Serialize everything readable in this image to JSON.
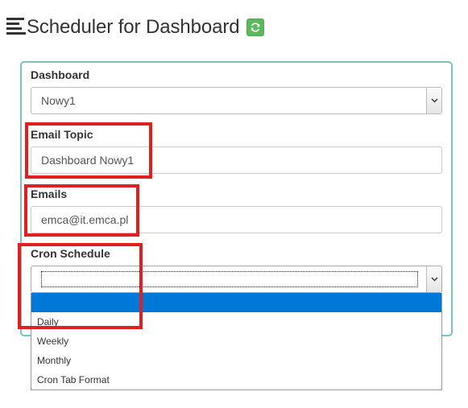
{
  "page": {
    "title": "Scheduler for Dashboard"
  },
  "icons": {
    "title": "list-icon",
    "refresh": "refresh-icon"
  },
  "colors": {
    "refresh_button": "#5cb85c",
    "panel_border": "#7cc3c0",
    "highlight": "#e02020",
    "selected_option": "#0078d7"
  },
  "form": {
    "dashboard": {
      "label": "Dashboard",
      "value": "Nowy1"
    },
    "email_topic": {
      "label": "Email Topic",
      "value": "Dashboard Nowy1"
    },
    "emails": {
      "label": "Emails",
      "value": "emca@it.emca.pl"
    },
    "cron_schedule": {
      "label": "Cron Schedule",
      "value": "",
      "options": [
        "",
        "Daily",
        "Weekly",
        "Monthly",
        "Cron Tab Format"
      ]
    }
  }
}
